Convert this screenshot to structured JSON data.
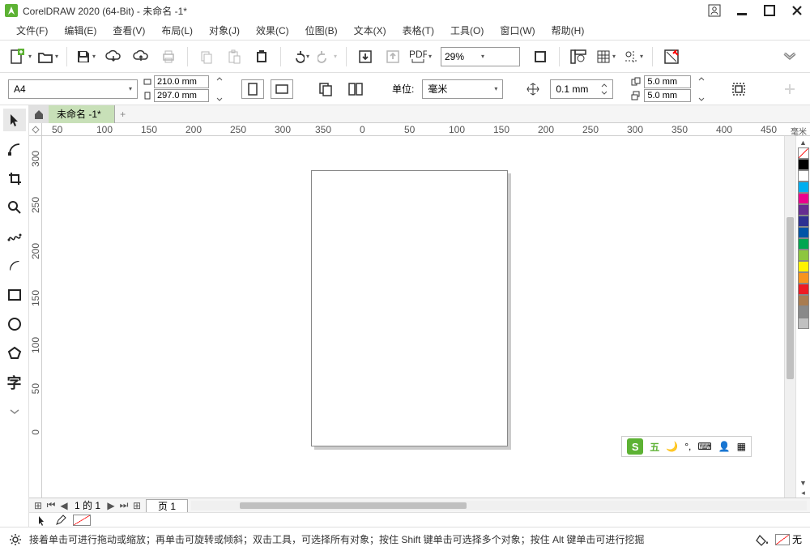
{
  "title": "CorelDRAW 2020 (64-Bit) - 未命名 -1*",
  "menu": [
    "文件(F)",
    "编辑(E)",
    "查看(V)",
    "布局(L)",
    "对象(J)",
    "效果(C)",
    "位图(B)",
    "文本(X)",
    "表格(T)",
    "工具(O)",
    "窗口(W)",
    "帮助(H)"
  ],
  "toolbar1": {
    "zoom": "29%"
  },
  "toolbar2": {
    "page_size": "A4",
    "width": "210.0 mm",
    "height": "297.0 mm",
    "unit_label": "单位:",
    "unit_value": "毫米",
    "nudge": "0.1 mm",
    "dup_x": "5.0 mm",
    "dup_y": "5.0 mm"
  },
  "doc_tab": "未命名 -1*",
  "ruler_h": [
    "50",
    "100",
    "150",
    "200",
    "250",
    "300",
    "350",
    "0",
    "50",
    "100",
    "150",
    "200",
    "250",
    "300",
    "350",
    "400",
    "450"
  ],
  "ruler_h_unit": "毫米",
  "ruler_v": [
    "300",
    "250",
    "200",
    "150",
    "100",
    "50",
    "0"
  ],
  "ime": {
    "label": "五"
  },
  "pagebar": {
    "counter": "1 的 1",
    "tab": "页 1"
  },
  "hint": "接着单击可进行拖动或缩放；再单击可旋转或倾斜；双击工具，可选择所有对象；按住 Shift 键单击可选择多个对象；按住 Alt 键单击可进行挖掘",
  "fill_none": "无",
  "palette": [
    "#000000",
    "#FFFFFF",
    "#00AEEF",
    "#EC008C",
    "#662D91",
    "#2E3192",
    "#0054A6",
    "#00A651",
    "#8DC63F",
    "#FFF200",
    "#F7941E",
    "#ED1C24",
    "#A97C50",
    "#898989",
    "#C0C0C0"
  ]
}
